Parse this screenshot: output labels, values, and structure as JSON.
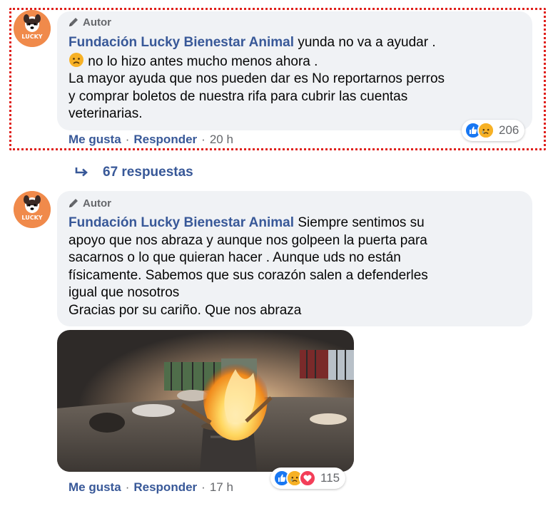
{
  "comments": [
    {
      "author_tag": "Autor",
      "author_name": "Fundación Lucky Bienestar Animal",
      "text_lines": [
        " yunda no va a ayudar .",
        " no lo hizo antes mucho menos ahora .",
        "La mayor ayuda que nos pueden dar es No reportarnos perros",
        "y comprar boletos de nuestra rifa para cubrir las cuentas",
        "veterinarias."
      ],
      "actions": {
        "like": "Me gusta",
        "reply": "Responder",
        "time": "20 h"
      },
      "reaction_count": "206",
      "reactions": [
        "like-icon",
        "sad-icon"
      ]
    },
    {
      "author_tag": "Autor",
      "author_name": "Fundación Lucky Bienestar Animal",
      "text_lines": [
        " Siempre sentimos su",
        "apoyo que nos abraza y aunque nos golpeen la puerta para",
        "sacarnos o lo que quieran hacer . Aunque uds no están",
        "físicamente. Sabemos que sus corazón salen a defenderles",
        "igual que nosotros",
        "Gracias por su cariño. Que nos abraza"
      ],
      "actions": {
        "like": "Me gusta",
        "reply": "Responder",
        "time": "17 h"
      },
      "reaction_count": "115",
      "reactions": [
        "like-icon",
        "sad-icon",
        "love-icon"
      ]
    }
  ],
  "replies_link": "67 respuestas",
  "colors": {
    "link": "#385898",
    "bubble": "#f0f2f5",
    "highlight": "#e0201c",
    "like": "#1877f2",
    "love": "#f33e58",
    "sad": "#f7b125"
  },
  "separator": "·"
}
